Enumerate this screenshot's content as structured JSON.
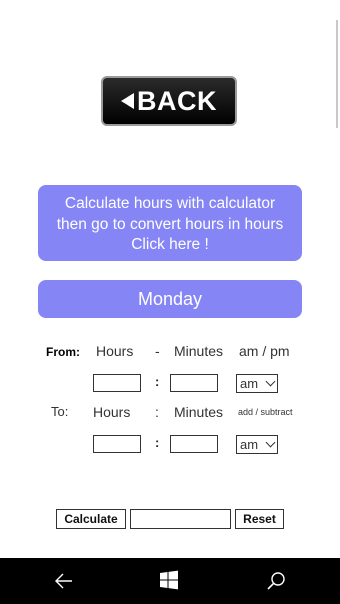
{
  "back_button": {
    "label": "BACK"
  },
  "calc_banner": {
    "line1": "Calculate hours with calculator",
    "line2": "then go to convert hours in hours",
    "line3": "Click here !"
  },
  "day_banner": {
    "label": "Monday"
  },
  "from_row": {
    "label": "From:",
    "hours_label": "Hours",
    "separator": "-",
    "minutes_label": "Minutes",
    "ampm_label": "am / pm",
    "colon": ":",
    "ampm_value": "am"
  },
  "to_row": {
    "label": "To:",
    "hours_label": "Hours",
    "separator": ":",
    "minutes_label": "Minutes",
    "addsub_label": "add / subtract",
    "colon": ":",
    "ampm_value": "am"
  },
  "actions": {
    "calculate_label": "Calculate",
    "reset_label": "Reset"
  },
  "nav": {
    "icons": [
      "back-arrow-icon",
      "windows-icon",
      "search-icon"
    ]
  },
  "colors": {
    "accent": "#8585f5",
    "navbar": "#000000"
  }
}
